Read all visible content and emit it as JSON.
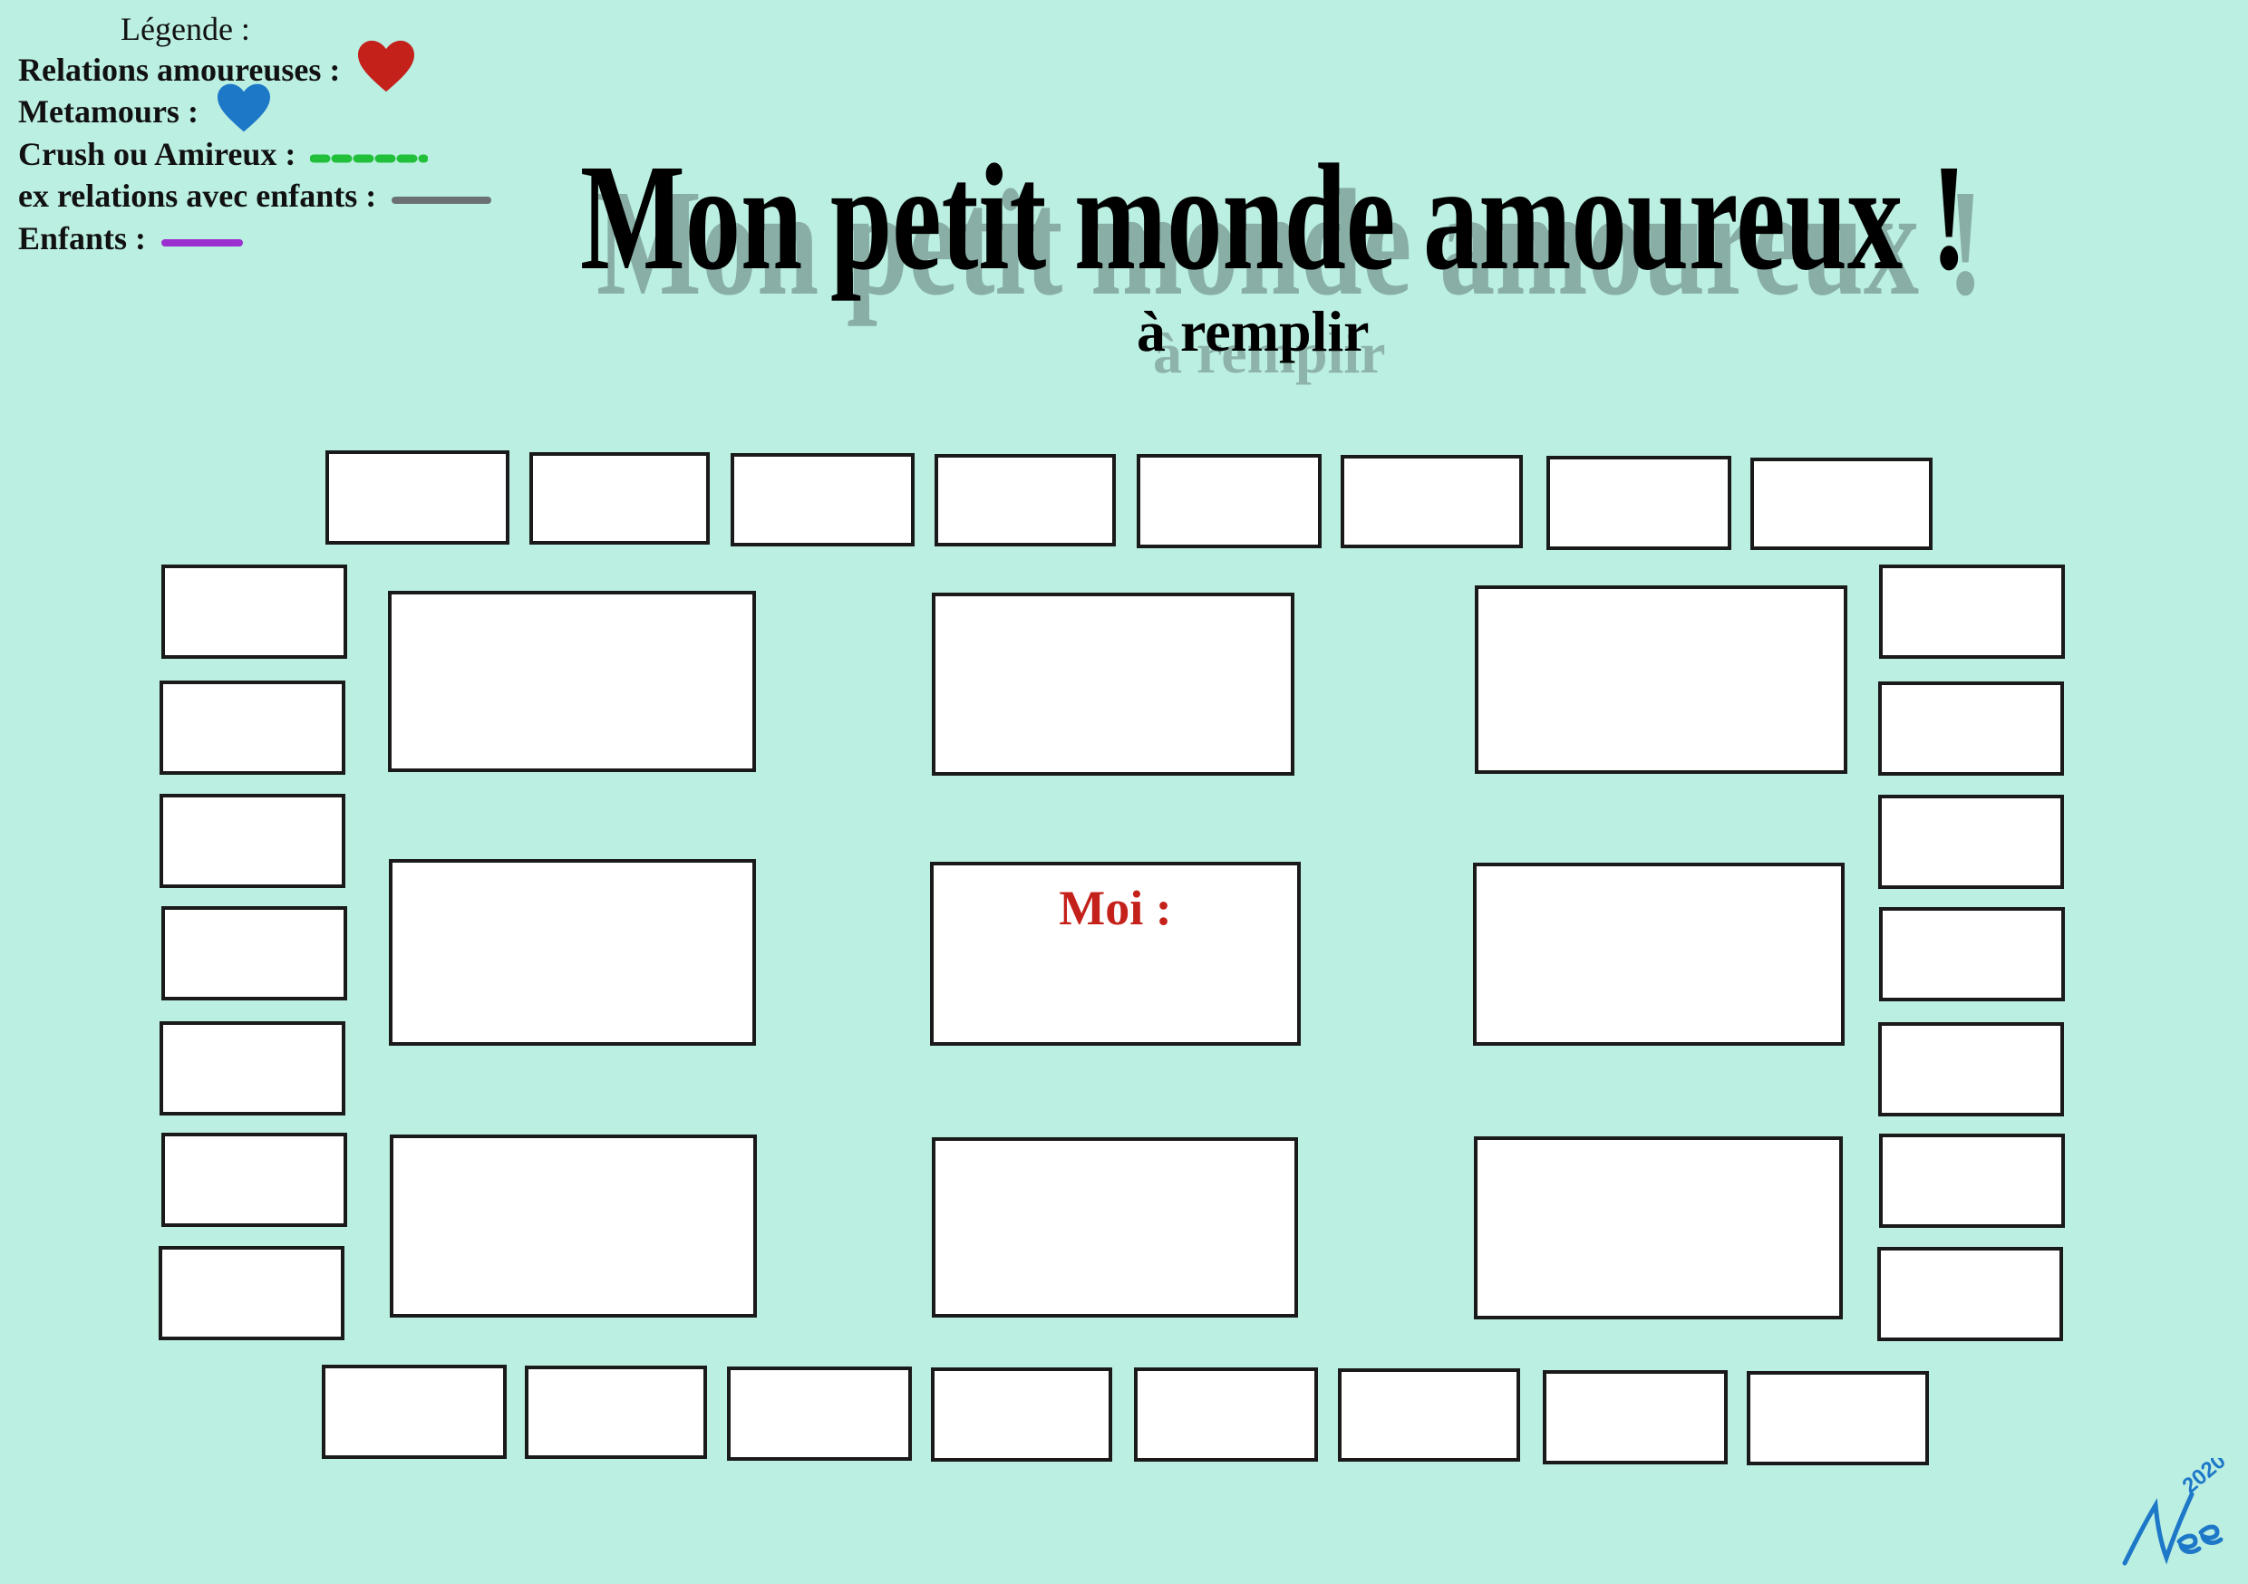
{
  "legend": {
    "title": "Légende :",
    "items": [
      {
        "label": "Relations amoureuses :",
        "symbol": "heart",
        "icon": "red-heart-icon",
        "color": "#c4211b"
      },
      {
        "label": "Metamours :",
        "symbol": "heart",
        "icon": "blue-heart-icon",
        "color": "#1e78c8"
      },
      {
        "label": "Crush ou Amireux :",
        "symbol": "dashed-line",
        "icon": "green-dashed-line",
        "color": "#22c03a"
      },
      {
        "label": "ex relations avec enfants :",
        "symbol": "solid-line",
        "icon": "gray-line",
        "color": "#6b7074"
      },
      {
        "label": "Enfants :",
        "symbol": "solid-line",
        "icon": "purple-line",
        "color": "#9b2fd0"
      }
    ]
  },
  "title": "Mon petit monde amoureux !",
  "subtitle": "à remplir",
  "center_box_label": "Moi :",
  "signature": {
    "year": "2020",
    "name": "Nee",
    "color": "#1e78c8"
  },
  "colors": {
    "background": "#bbefe2",
    "box_fill": "#ffffff",
    "box_border": "#1a1a1a",
    "moi_label": "#c4211b"
  }
}
